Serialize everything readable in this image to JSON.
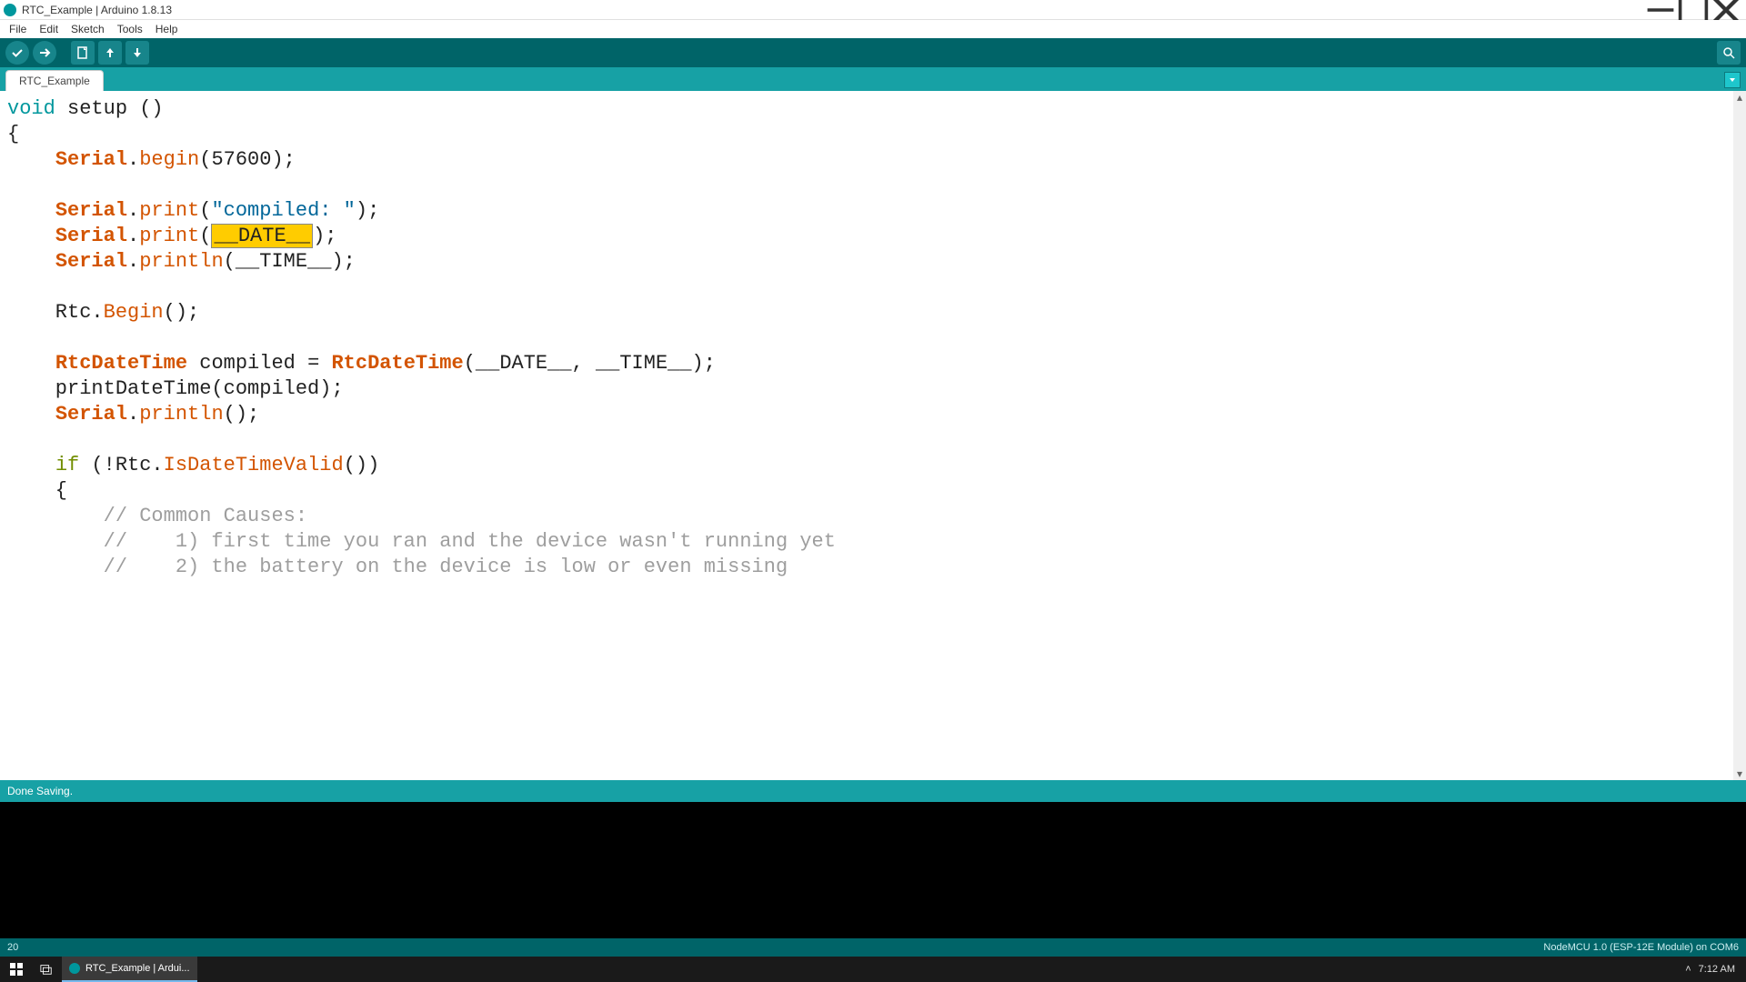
{
  "window": {
    "title": "RTC_Example | Arduino 1.8.13"
  },
  "menu": {
    "file": "File",
    "edit": "Edit",
    "sketch": "Sketch",
    "tools": "Tools",
    "help": "Help"
  },
  "tab": {
    "name": "RTC_Example"
  },
  "code": {
    "l1_void": "void",
    "l1_setup": " setup ()",
    "l2": "{",
    "l3_serial": "Serial",
    "l3_dot": ".",
    "l3_begin": "begin",
    "l3_args": "(57600);",
    "l5_serial": "Serial",
    "l5_dot": ".",
    "l5_print": "print",
    "l5_open": "(",
    "l5_str": "\"compiled: \"",
    "l5_close": ");",
    "l6_serial": "Serial",
    "l6_dot": ".",
    "l6_print": "print",
    "l6_open": "(",
    "l6_sel": "__DATE__",
    "l6_close": ");",
    "l7_serial": "Serial",
    "l7_dot": ".",
    "l7_println": "println",
    "l7_args": "(__TIME__);",
    "l9_rtc": "    Rtc.",
    "l9_begin": "Begin",
    "l9_end": "();",
    "l11_class1": "RtcDateTime",
    "l11_mid": " compiled = ",
    "l11_class2": "RtcDateTime",
    "l11_args": "(__DATE__, __TIME__);",
    "l12": "    printDateTime(compiled);",
    "l13_serial": "Serial",
    "l13_dot": ".",
    "l13_println": "println",
    "l13_end": "();",
    "l15_if": "if",
    "l15_pre": " (!Rtc.",
    "l15_method": "IsDateTimeValid",
    "l15_end": "())",
    "l16": "    {",
    "l17": "        // Common Causes:",
    "l18": "        //    1) first time you ran and the device wasn't running yet",
    "l19": "        //    2) the battery on the device is low or even missing"
  },
  "status": {
    "message": "Done Saving."
  },
  "bottom": {
    "line": "20",
    "board": "NodeMCU 1.0 (ESP-12E Module) on COM6"
  },
  "taskbar": {
    "app": "RTC_Example | Ardui...",
    "time": "7:12 AM"
  }
}
